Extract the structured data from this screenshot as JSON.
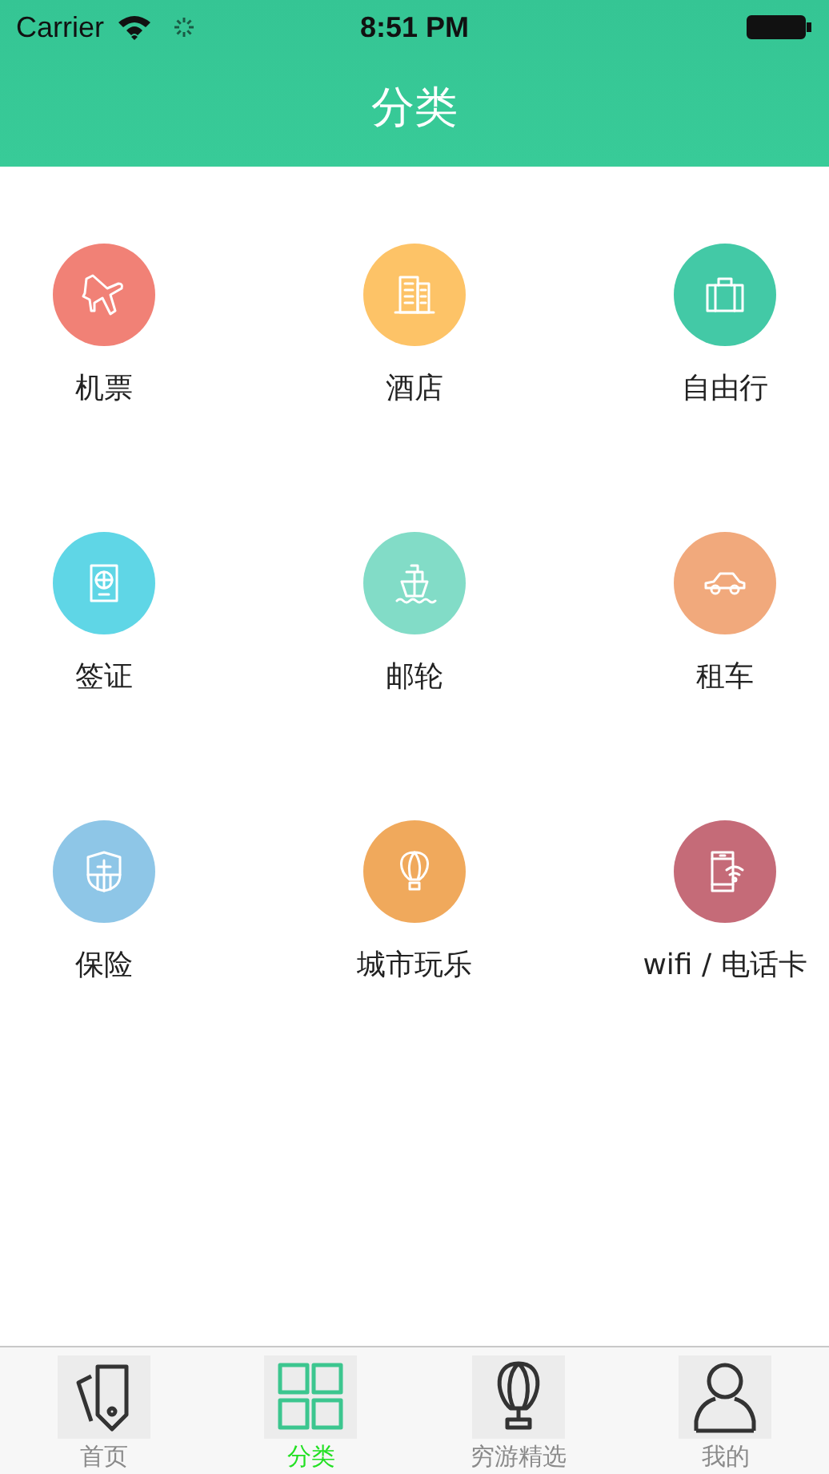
{
  "status_bar": {
    "carrier": "Carrier",
    "time": "8:51 PM"
  },
  "nav": {
    "title": "分类"
  },
  "categories": [
    {
      "label": "机票",
      "kind": "plane",
      "color": "#f18176"
    },
    {
      "label": "酒店",
      "kind": "building",
      "color": "#fdc367"
    },
    {
      "label": "自由行",
      "kind": "suitcase",
      "color": "#43c9a6"
    },
    {
      "label": "签证",
      "kind": "passport",
      "color": "#5fd6e6"
    },
    {
      "label": "邮轮",
      "kind": "ship",
      "color": "#82dcc7"
    },
    {
      "label": "租车",
      "kind": "car",
      "color": "#f1a97c"
    },
    {
      "label": "保险",
      "kind": "shield",
      "color": "#8ec6e7"
    },
    {
      "label": "城市玩乐",
      "kind": "balloon",
      "color": "#f0a95c"
    },
    {
      "label": "wifi / 电话卡",
      "kind": "phone",
      "color": "#c56b78"
    }
  ],
  "tabs": [
    {
      "label": "首页",
      "kind": "tag",
      "selected": false
    },
    {
      "label": "分类",
      "kind": "grid",
      "selected": true
    },
    {
      "label": "穷游精选",
      "kind": "balloon",
      "selected": false
    },
    {
      "label": "我的",
      "kind": "person",
      "selected": false
    }
  ]
}
